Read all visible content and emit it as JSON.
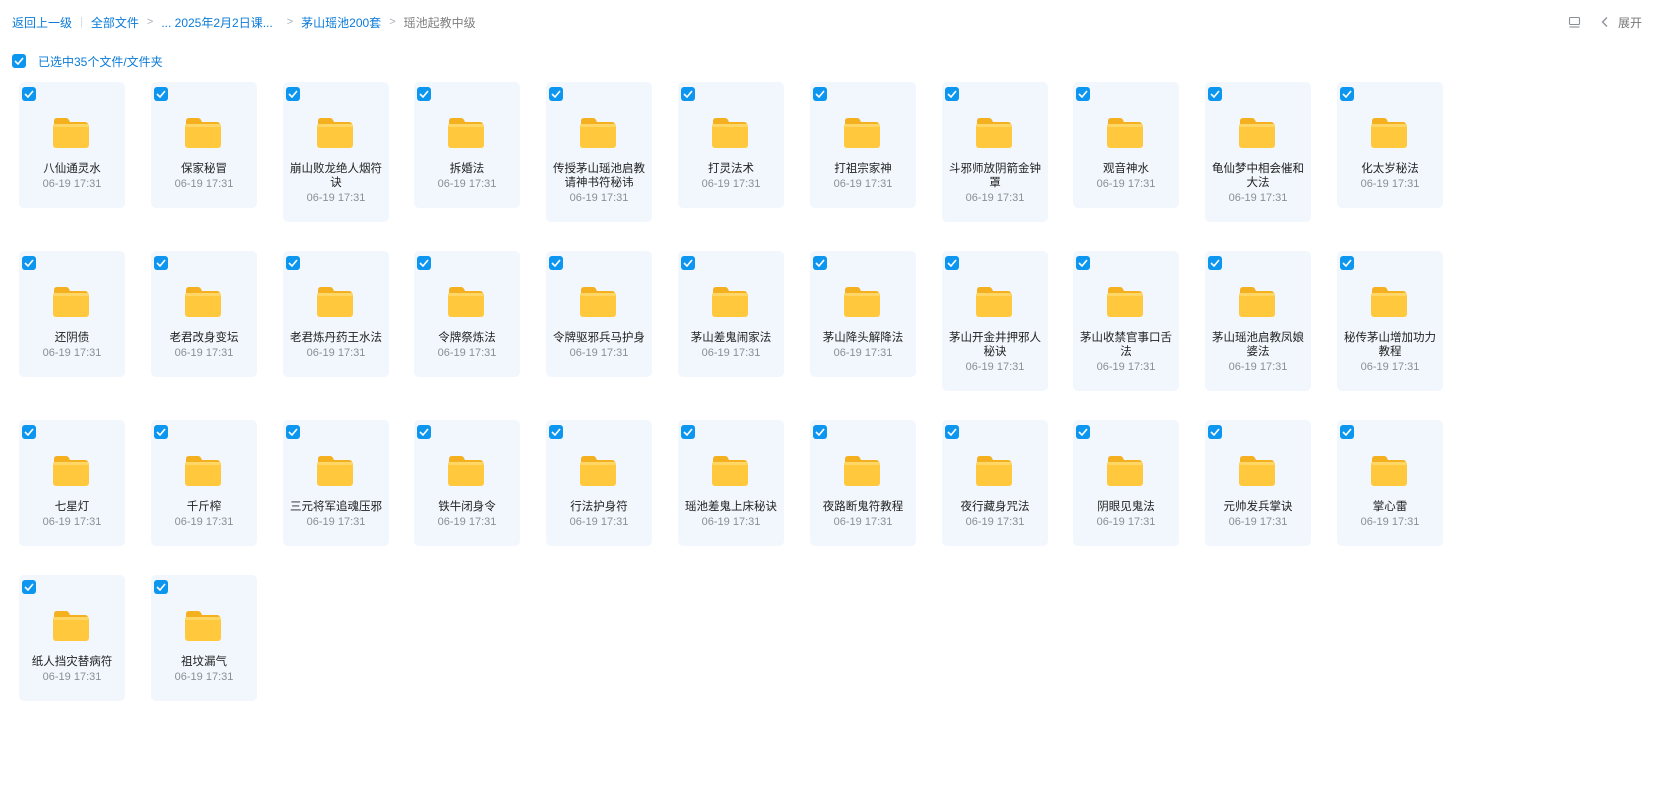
{
  "breadcrumb": {
    "back": "返回上一级",
    "all": "全部文件",
    "ellipsis": "... 2025年2月2日课...",
    "parent": "茅山瑶池200套",
    "current": "瑶池起教中级"
  },
  "toolbar": {
    "expand_label": "展开"
  },
  "selection": {
    "text": "已选中35个文件/文件夹"
  },
  "colors": {
    "accent": "#0d96f0",
    "folder": "#ffc83d",
    "card_bg": "#f1f7fc"
  },
  "folders": [
    {
      "name": "八仙通灵水",
      "time": "06-19 17:31"
    },
    {
      "name": "保家秘冒",
      "time": "06-19 17:31"
    },
    {
      "name": "崩山败龙绝人烟符诀",
      "time": "06-19 17:31"
    },
    {
      "name": "拆婚法",
      "time": "06-19 17:31"
    },
    {
      "name": "传授茅山瑶池启教请神书符秘讳",
      "time": "06-19 17:31"
    },
    {
      "name": "打灵法术",
      "time": "06-19 17:31"
    },
    {
      "name": "打祖宗家神",
      "time": "06-19 17:31"
    },
    {
      "name": "斗邪师放阴箭金钟罩",
      "time": "06-19 17:31"
    },
    {
      "name": "观音神水",
      "time": "06-19 17:31"
    },
    {
      "name": "龟仙梦中相会催和大法",
      "time": "06-19 17:31"
    },
    {
      "name": "化太岁秘法",
      "time": "06-19 17:31"
    },
    {
      "name": "还阴债",
      "time": "06-19 17:31"
    },
    {
      "name": "老君改身变坛",
      "time": "06-19 17:31"
    },
    {
      "name": "老君炼丹药王水法",
      "time": "06-19 17:31"
    },
    {
      "name": "令牌祭炼法",
      "time": "06-19 17:31"
    },
    {
      "name": "令牌驱邪兵马护身",
      "time": "06-19 17:31"
    },
    {
      "name": "茅山差鬼闹家法",
      "time": "06-19 17:31"
    },
    {
      "name": "茅山降头解降法",
      "time": "06-19 17:31"
    },
    {
      "name": "茅山开金井押邪人秘诀",
      "time": "06-19 17:31"
    },
    {
      "name": "茅山收禁官事口舌法",
      "time": "06-19 17:31"
    },
    {
      "name": "茅山瑶池启教凤娘婆法",
      "time": "06-19 17:31"
    },
    {
      "name": "秘传茅山增加功力教程",
      "time": "06-19 17:31"
    },
    {
      "name": "七星灯",
      "time": "06-19 17:31"
    },
    {
      "name": "千斤榨",
      "time": "06-19 17:31"
    },
    {
      "name": "三元将军追魂压邪",
      "time": "06-19 17:31"
    },
    {
      "name": "铁牛闭身令",
      "time": "06-19 17:31"
    },
    {
      "name": "行法护身符",
      "time": "06-19 17:31"
    },
    {
      "name": "瑶池差鬼上床秘诀",
      "time": "06-19 17:31"
    },
    {
      "name": "夜路断鬼符教程",
      "time": "06-19 17:31"
    },
    {
      "name": "夜行藏身咒法",
      "time": "06-19 17:31"
    },
    {
      "name": "阴眼见鬼法",
      "time": "06-19 17:31"
    },
    {
      "name": "元帅发兵掌诀",
      "time": "06-19 17:31"
    },
    {
      "name": "掌心雷",
      "time": "06-19 17:31"
    },
    {
      "name": "纸人挡灾替病符",
      "time": "06-19 17:31"
    },
    {
      "name": "祖坟漏气",
      "time": "06-19 17:31"
    }
  ]
}
